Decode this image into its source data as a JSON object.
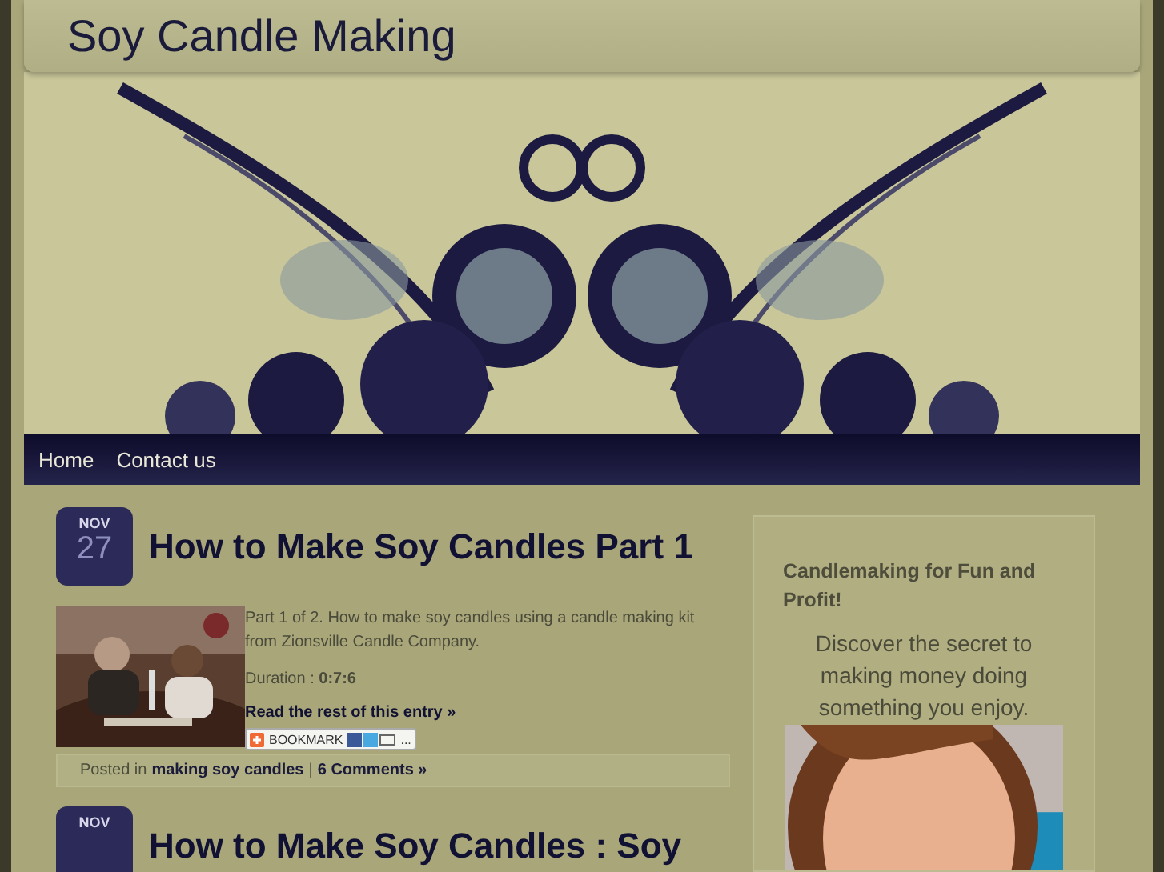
{
  "site": {
    "title": "Soy Candle Making"
  },
  "nav": [
    {
      "label": "Home"
    },
    {
      "label": "Contact us"
    }
  ],
  "posts": [
    {
      "month": "NOV",
      "day": "27",
      "title": "How to Make Soy Candles Part 1",
      "excerpt": "Part 1 of 2. How to make soy candles using a candle making kit from Zionsville Candle Company.",
      "duration": "Duration : **0:7:6**",
      "read_more": "Read the rest of this entry »",
      "bookmark": {
        "label": "BOOKMARK",
        "more": "..."
      },
      "posted_in": "Posted in",
      "category": "making soy candles",
      "separator": "|",
      "comments": "6 Comments »"
    },
    {
      "month": "NOV",
      "title": "How to Make Soy Candles : Soy"
    }
  ],
  "sidebar": {
    "heading": "Candlemaking for Fun and Profit!",
    "text": "Discover the secret to making money doing something you enjoy."
  }
}
